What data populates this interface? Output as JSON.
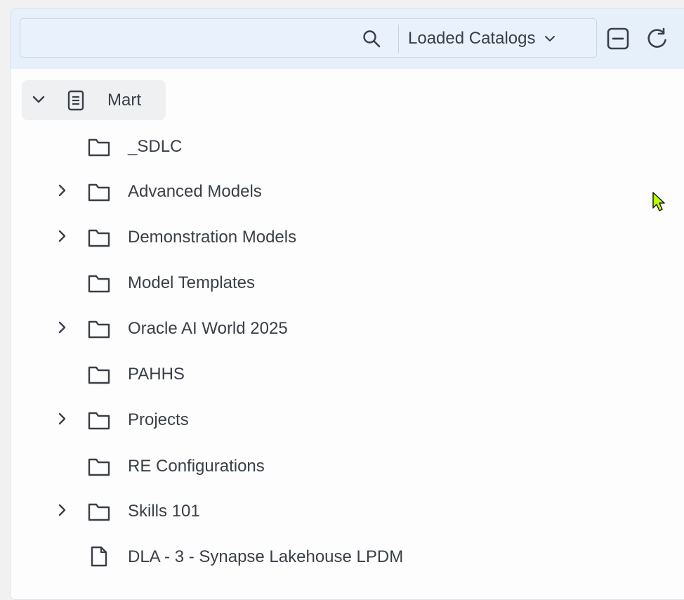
{
  "toolbar": {
    "catalog_selector_label": "Loaded Catalogs"
  },
  "tree": {
    "root": {
      "label": "Mart",
      "expanded": true,
      "icon": "document-list-icon"
    },
    "items": [
      {
        "label": "_SDLC",
        "type": "folder",
        "expandable": false
      },
      {
        "label": "Advanced Models",
        "type": "folder",
        "expandable": true
      },
      {
        "label": "Demonstration Models",
        "type": "folder",
        "expandable": true
      },
      {
        "label": "Model Templates",
        "type": "folder",
        "expandable": false
      },
      {
        "label": "Oracle AI World 2025",
        "type": "folder",
        "expandable": true
      },
      {
        "label": "PAHHS",
        "type": "folder",
        "expandable": false
      },
      {
        "label": "Projects",
        "type": "folder",
        "expandable": true
      },
      {
        "label": "RE Configurations",
        "type": "folder",
        "expandable": false
      },
      {
        "label": "Skills 101",
        "type": "folder",
        "expandable": true
      },
      {
        "label": "DLA - 3 - Synapse Lakehouse LPDM",
        "type": "file",
        "expandable": false
      }
    ]
  },
  "colors": {
    "toolbar_bg": "#e6f0fb",
    "text": "#3a3f47",
    "root_highlight": "#eef0f2",
    "cursor": "#b6ff00"
  }
}
